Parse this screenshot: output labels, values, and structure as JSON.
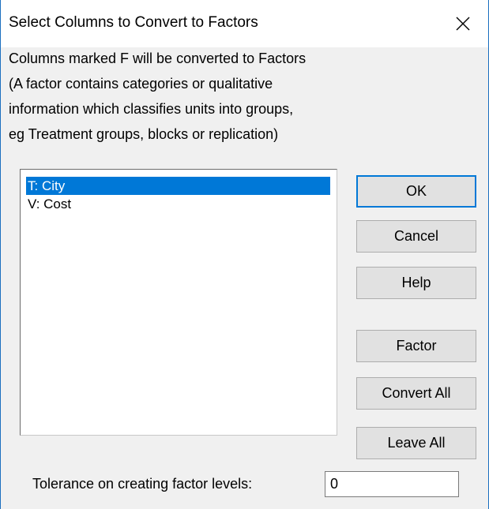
{
  "window": {
    "title": "Select Columns to Convert to Factors",
    "close_icon": "close-x-icon"
  },
  "info": {
    "lines": [
      "Columns marked F will be converted to Factors",
      "(A factor contains categories or qualitative",
      "information which classifies units into groups,",
      "eg Treatment groups, blocks or replication)"
    ]
  },
  "columns_list": {
    "items": [
      {
        "label": "T: City",
        "selected": true
      },
      {
        "label": "V: Cost",
        "selected": false
      }
    ]
  },
  "buttons": {
    "ok": "OK",
    "cancel": "Cancel",
    "help": "Help",
    "factor": "Factor",
    "convert_all": "Convert All",
    "leave_all": "Leave All"
  },
  "tolerance": {
    "label": "Tolerance on creating factor levels:",
    "value": "0"
  },
  "colors": {
    "selection": "#0078d7",
    "dialog_bg": "#f0f0f0",
    "window_border": "#1c6fbf"
  }
}
